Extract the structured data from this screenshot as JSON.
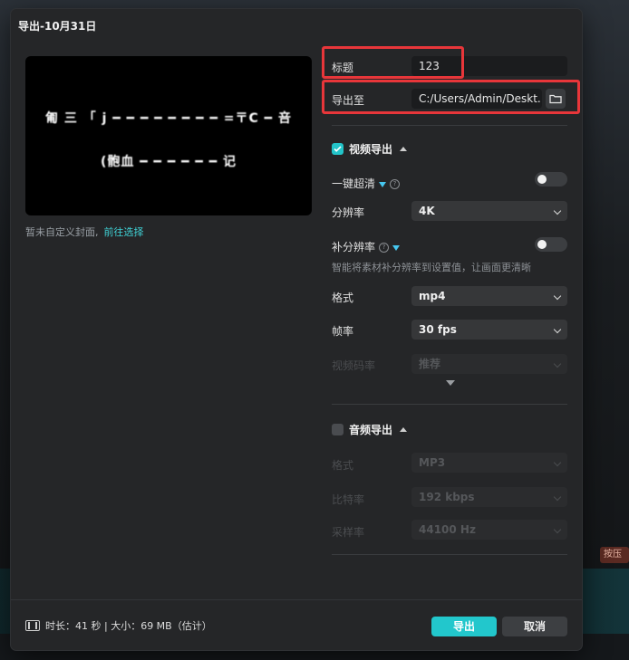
{
  "dialog": {
    "title": "导出-10月31日"
  },
  "preview": {
    "line1": "匍 三 「 j ━ ━ ━ ━ ━ ━ ━ ━ =〒C ━ 咅",
    "line2": "(骲血 ━ ━ ━ ━ ━ ━ 记",
    "cover_hint": "暂未自定义封面,",
    "cover_link": "前往选择"
  },
  "form": {
    "title_label": "标题",
    "title_value": "123",
    "export_to_label": "导出至",
    "export_path": "C:/Users/Admin/Deskt...",
    "video_section": "视频导出",
    "one_click_hd": "一键超清",
    "resolution_label": "分辨率",
    "resolution_value": "4K",
    "frame_interp_label": "补分辨率",
    "frame_interp_hint": "智能将素材补分辨率到设置值，让画面更清晰",
    "format_label": "格式",
    "format_value": "mp4",
    "fps_label": "帧率",
    "fps_value": "30 fps",
    "bitrate_label": "视频码率",
    "bitrate_value": "推荐",
    "audio_section": "音频导出",
    "audio_format_label": "格式",
    "audio_format_value": "MP3",
    "audio_bitrate_label": "比特率",
    "audio_bitrate_value": "192 kbps",
    "sample_rate_label": "采样率",
    "sample_rate_value": "44100 Hz"
  },
  "footer": {
    "info": "时长：41 秒 | 大小：69 MB（估计）",
    "export_button": "导出",
    "cancel_button": "取消"
  },
  "background": {
    "right_button": "按压"
  },
  "colors": {
    "accent": "#22c7cc",
    "highlight_box": "#e8363a",
    "dialog_bg": "#252628"
  }
}
